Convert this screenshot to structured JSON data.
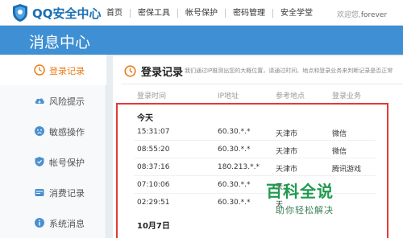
{
  "brand": {
    "logo_text": "QQ安全中心",
    "logo_color": "#1b6fb3"
  },
  "nav": [
    "首页",
    "密保工具",
    "帐号保护",
    "密码管理",
    "安全学堂"
  ],
  "welcome": {
    "prefix": "欢迎您,",
    "user": "forever"
  },
  "banner": {
    "title": "消息中心",
    "color": "#3e8fd3"
  },
  "sidebar": [
    {
      "label": "登录记录",
      "icon": "clock-icon",
      "active": true
    },
    {
      "label": "风险提示",
      "icon": "cloud-icon"
    },
    {
      "label": "敏感操作",
      "icon": "face-icon"
    },
    {
      "label": "帐号保护",
      "icon": "shield-icon"
    },
    {
      "label": "消费记录",
      "icon": "wallet-icon"
    },
    {
      "label": "系统消息",
      "icon": "info-icon"
    }
  ],
  "panel": {
    "title": "登录记录",
    "description": "我们通过IP推测出您的大概位置，请通过时间、地点和登录业务来判断记录是否正常",
    "columns": [
      "登录时间",
      "IP地址",
      "参考地点",
      "登录业务"
    ]
  },
  "groups": [
    {
      "label": "今天",
      "rows": [
        {
          "time": "15:31:07",
          "ip": "60.30.*.*",
          "place": "天津市",
          "service": "微信"
        },
        {
          "time": "08:55:20",
          "ip": "60.30.*.*",
          "place": "天津市",
          "service": "微信"
        },
        {
          "time": "08:37:16",
          "ip": "180.213.*.*",
          "place": "天津市",
          "service": "腾讯游戏"
        },
        {
          "time": "07:10:06",
          "ip": "60.30.*.*",
          "place": "天",
          "service": ""
        },
        {
          "time": "02:29:51",
          "ip": "60.30.*.*",
          "place": "天",
          "service": ""
        }
      ]
    },
    {
      "label": "10月7日",
      "rows": []
    }
  ],
  "watermark": {
    "big": "百科全说",
    "small": "助你轻松解决"
  },
  "highlight_color": "#e53935",
  "accent_color": "#e97d1c"
}
